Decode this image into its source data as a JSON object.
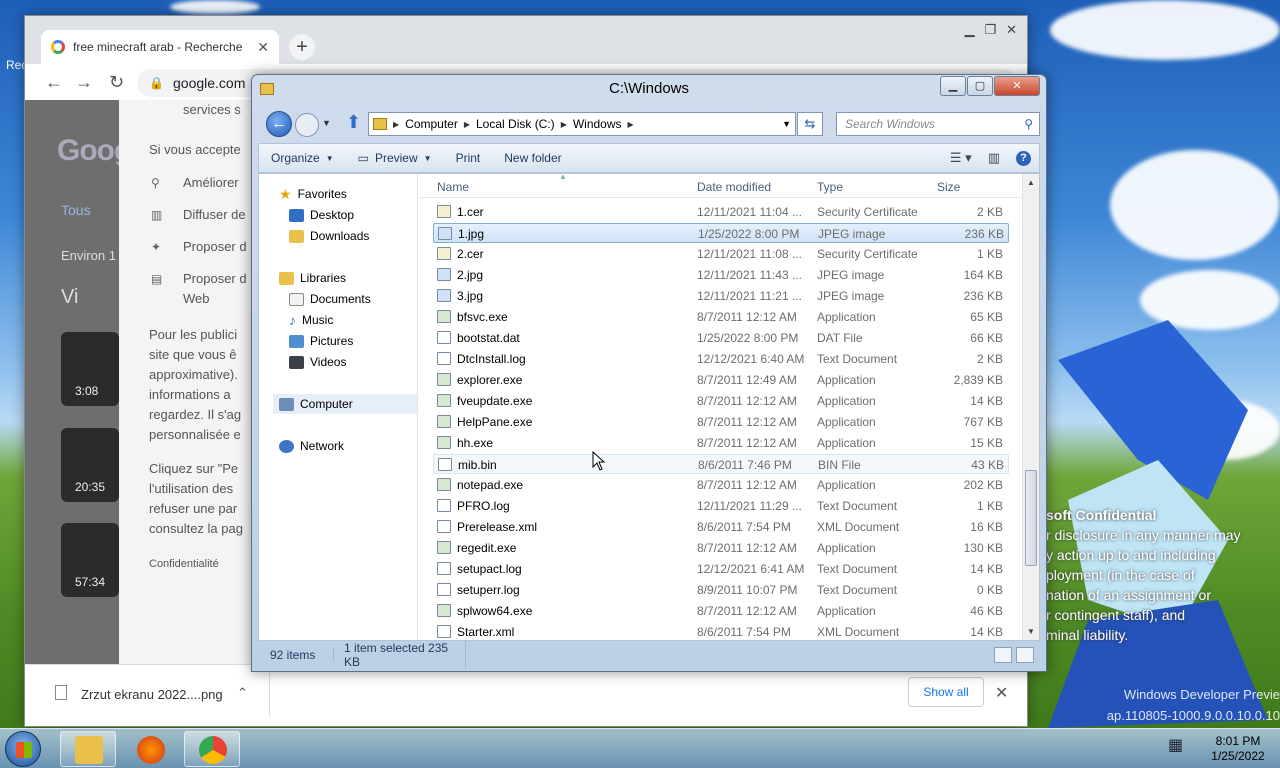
{
  "desktop": {
    "left_label": "Rec",
    "confidential_title": "soft Confidential",
    "confidential_lines": [
      "r disclosure in any manner may",
      "y action up to and including",
      "ployment (in the case of",
      "nation of an assignment or",
      "r contingent staff), and",
      "minal liability."
    ],
    "build_lines": [
      "Windows Developer Previe",
      "ap.110805-1000.9.0.0.10.0.10"
    ]
  },
  "chrome": {
    "tab_title": "free minecraft arab - Recherche",
    "omnibox": "google.com",
    "google": {
      "logo": "Goog",
      "tab_all": "Tous",
      "results": "Environ 1",
      "videos": "Vi",
      "thumbs": [
        {
          "time": "3:08"
        },
        {
          "time": "20:35"
        },
        {
          "time": "57:34"
        }
      ]
    },
    "consent": {
      "line_services": "services s",
      "line_accept": "Si vous accepte",
      "item_ameliorer": "Améliorer",
      "item_diffuser": "Diffuser de",
      "item_proposer1": "Proposer d",
      "item_proposer2": "Proposer d",
      "item_web": "Web",
      "para1": [
        "Pour les publici",
        "site que vous ê",
        "approximative).",
        "informations a",
        "regardez. Il s'ag",
        "personnalisée e"
      ],
      "para2": [
        "Cliquez sur \"Pe",
        "l'utilisation des",
        "refuser une par",
        "consultez la pag"
      ],
      "footer": "Confidentialité"
    },
    "download": {
      "file": "Zrzut ekranu 2022....png",
      "show_all": "Show all"
    }
  },
  "explorer": {
    "title": "C:\\Windows",
    "breadcrumb": [
      "Computer",
      "Local Disk (C:)",
      "Windows"
    ],
    "search_placeholder": "Search Windows",
    "commands": {
      "organize": "Organize",
      "preview": "Preview",
      "print": "Print",
      "new_folder": "New folder"
    },
    "nav": {
      "favorites": "Favorites",
      "desktop": "Desktop",
      "downloads": "Downloads",
      "libraries": "Libraries",
      "documents": "Documents",
      "music": "Music",
      "pictures": "Pictures",
      "videos": "Videos",
      "computer": "Computer",
      "network": "Network"
    },
    "columns": {
      "name": "Name",
      "date": "Date modified",
      "type": "Type",
      "size": "Size"
    },
    "files": [
      {
        "name": "1.cer",
        "date": "12/11/2021 11:04 ...",
        "type": "Security Certificate",
        "size": "2 KB"
      },
      {
        "name": "1.jpg",
        "date": "1/25/2022 8:00 PM",
        "type": "JPEG image",
        "size": "236 KB"
      },
      {
        "name": "2.cer",
        "date": "12/11/2021 11:08 ...",
        "type": "Security Certificate",
        "size": "1 KB"
      },
      {
        "name": "2.jpg",
        "date": "12/11/2021 11:43 ...",
        "type": "JPEG image",
        "size": "164 KB"
      },
      {
        "name": "3.jpg",
        "date": "12/11/2021 11:21 ...",
        "type": "JPEG image",
        "size": "236 KB"
      },
      {
        "name": "bfsvc.exe",
        "date": "8/7/2011 12:12 AM",
        "type": "Application",
        "size": "65 KB"
      },
      {
        "name": "bootstat.dat",
        "date": "1/25/2022 8:00 PM",
        "type": "DAT File",
        "size": "66 KB"
      },
      {
        "name": "DtcInstall.log",
        "date": "12/12/2021 6:40 AM",
        "type": "Text Document",
        "size": "2 KB"
      },
      {
        "name": "explorer.exe",
        "date": "8/7/2011 12:49 AM",
        "type": "Application",
        "size": "2,839 KB"
      },
      {
        "name": "fveupdate.exe",
        "date": "8/7/2011 12:12 AM",
        "type": "Application",
        "size": "14 KB"
      },
      {
        "name": "HelpPane.exe",
        "date": "8/7/2011 12:12 AM",
        "type": "Application",
        "size": "767 KB"
      },
      {
        "name": "hh.exe",
        "date": "8/7/2011 12:12 AM",
        "type": "Application",
        "size": "15 KB"
      },
      {
        "name": "mib.bin",
        "date": "8/6/2011 7:46 PM",
        "type": "BIN File",
        "size": "43 KB"
      },
      {
        "name": "notepad.exe",
        "date": "8/7/2011 12:12 AM",
        "type": "Application",
        "size": "202 KB"
      },
      {
        "name": "PFRO.log",
        "date": "12/11/2021 11:29 ...",
        "type": "Text Document",
        "size": "1 KB"
      },
      {
        "name": "Prerelease.xml",
        "date": "8/6/2011 7:54 PM",
        "type": "XML Document",
        "size": "16 KB"
      },
      {
        "name": "regedit.exe",
        "date": "8/7/2011 12:12 AM",
        "type": "Application",
        "size": "130 KB"
      },
      {
        "name": "setupact.log",
        "date": "12/12/2021 6:41 AM",
        "type": "Text Document",
        "size": "14 KB"
      },
      {
        "name": "setuperr.log",
        "date": "8/9/2011 10:07 PM",
        "type": "Text Document",
        "size": "0 KB"
      },
      {
        "name": "splwow64.exe",
        "date": "8/7/2011 12:12 AM",
        "type": "Application",
        "size": "46 KB"
      },
      {
        "name": "Starter.xml",
        "date": "8/6/2011 7:54 PM",
        "type": "XML Document",
        "size": "14 KB"
      }
    ],
    "status": {
      "count": "92 items",
      "selection": "1 item selected  235 KB"
    }
  },
  "taskbar": {
    "time": "8:01 PM",
    "date": "1/25/2022"
  }
}
